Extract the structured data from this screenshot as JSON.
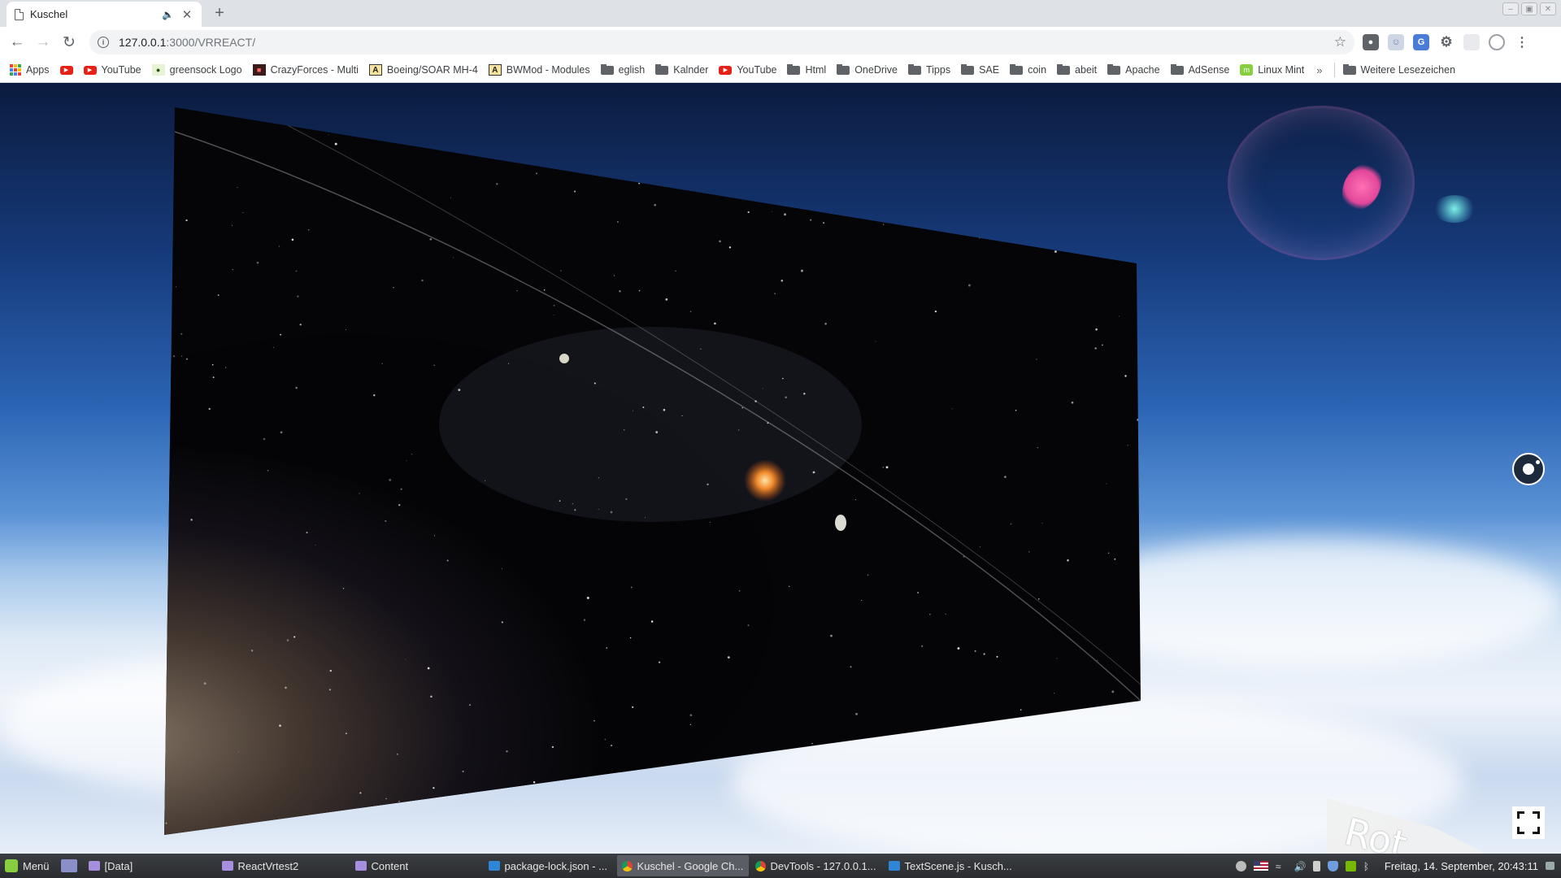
{
  "browser": {
    "tab_title": "Kuschel",
    "tab_audio_icon": "speaker-icon",
    "url_host": "127.0.0.1",
    "url_path": ":3000/VRREACT/"
  },
  "bookmarks": [
    {
      "label": "Apps",
      "icon": "apps-grid-icon"
    },
    {
      "label": "",
      "icon": "youtube-icon"
    },
    {
      "label": "YouTube",
      "icon": "youtube-icon"
    },
    {
      "label": "greensock Logo",
      "icon": "greensock-icon"
    },
    {
      "label": "CrazyForces - Multi",
      "icon": "crazyforces-icon"
    },
    {
      "label": "Boeing/SOAR MH-4",
      "icon": "a-box-icon"
    },
    {
      "label": "BWMod - Modules",
      "icon": "a-box-icon"
    },
    {
      "label": "eglish",
      "icon": "folder-icon"
    },
    {
      "label": "Kalnder",
      "icon": "folder-icon"
    },
    {
      "label": "YouTube",
      "icon": "youtube-icon"
    },
    {
      "label": "Html",
      "icon": "folder-icon"
    },
    {
      "label": "OneDrive",
      "icon": "folder-icon"
    },
    {
      "label": "Tipps",
      "icon": "folder-icon"
    },
    {
      "label": "SAE",
      "icon": "folder-icon"
    },
    {
      "label": "coin",
      "icon": "folder-icon"
    },
    {
      "label": "abeit",
      "icon": "folder-icon"
    },
    {
      "label": "Apache",
      "icon": "folder-icon"
    },
    {
      "label": "AdSense",
      "icon": "folder-icon"
    },
    {
      "label": "Linux Mint",
      "icon": "linux-mint-icon"
    }
  ],
  "bookmarks_more": "»",
  "bookmarks_other": "Weitere Lesezeichen",
  "scene": {
    "rot_label": "Rot"
  },
  "taskbar": {
    "menu_label": "Menü",
    "items": [
      {
        "label": "[Data]",
        "icon": "folder-icon",
        "active": false
      },
      {
        "label": "ReactVrtest2",
        "icon": "folder-icon",
        "active": false
      },
      {
        "label": "Content",
        "icon": "folder-icon",
        "active": false
      },
      {
        "label": "package-lock.json - ...",
        "icon": "vscode-icon",
        "active": false
      },
      {
        "label": "Kuschel - Google Ch...",
        "icon": "chrome-icon",
        "active": true
      },
      {
        "label": "DevTools - 127.0.0.1...",
        "icon": "chrome-icon",
        "active": false
      },
      {
        "label": "TextScene.js - Kusch...",
        "icon": "vscode-icon",
        "active": false
      }
    ],
    "clock": "Freitag, 14. September, 20:43:11"
  },
  "colors": {
    "taskbar_bg": "#2a2c2f",
    "accent_mint": "#87cf3e",
    "youtube_red": "#e62117"
  }
}
